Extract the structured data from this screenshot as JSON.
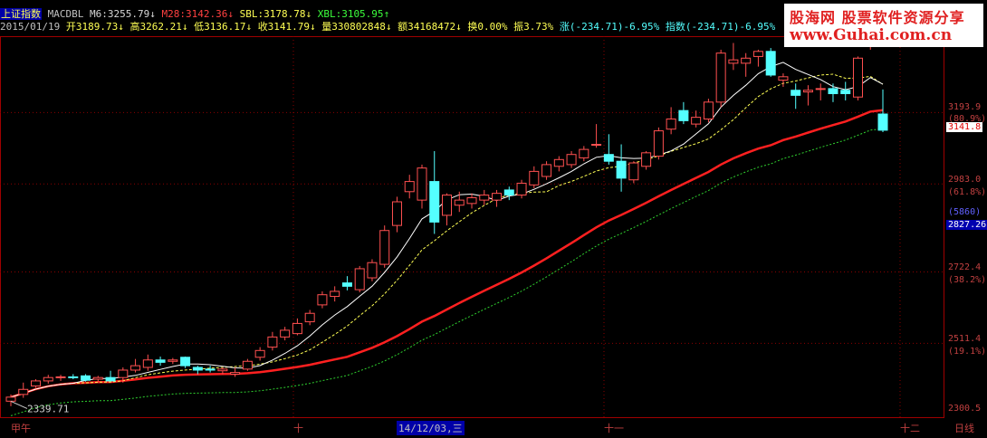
{
  "header": {
    "title": "上证指数",
    "ma_name": "MACDBL",
    "m6": "M6:3255.79",
    "m6_arrow": "↓",
    "m28": "M28:3142.36",
    "m28_arrow": "↓",
    "sbl": "SBL:3178.78",
    "sbl_arrow": "↓",
    "xbl": "XBL:3105.95",
    "xbl_arrow": "↑",
    "date": "2015/01/19",
    "open": "开3189.73",
    "open_arrow": "↓",
    "high": "高3262.21",
    "high_arrow": "↓",
    "low": "低3136.17",
    "low_arrow": "↓",
    "close": "收3141.79",
    "close_arrow": "↓",
    "volume": "量330802848",
    "volume_arrow": "↓",
    "amount": "额34168472",
    "amount_arrow": "↓",
    "turnover": "换0.00%",
    "amplitude": "振3.73%",
    "change": "涨(-234.71)-6.95%",
    "index_change": "指数(-234.71)-6.95%"
  },
  "y_axis": {
    "labels": [
      "3193.9",
      "(80.9%)",
      "2983.0",
      "(61.8%)",
      "(5860)",
      "2827.26",
      "2722.4",
      "(38.2%)",
      "2511.4",
      "(19.1%)",
      "2300.5"
    ],
    "current_price": "3141.8",
    "low_marker": "2339.71"
  },
  "bottom_bar": {
    "labels": [
      "甲午",
      "十",
      "14/12/03,三",
      "十一",
      "十二",
      "日线"
    ]
  },
  "logo": {
    "line1": "股海网 股票软件资源分享",
    "line2": "www.Guhai.com.cn"
  },
  "colors": {
    "up": "#ff5050",
    "down": "#54ffff",
    "ma_short": "#ffffff",
    "ma_mid": "#ffff54",
    "ma_long": "#ff2020",
    "ma_xbl": "#2fcf2f"
  },
  "chart_data": {
    "type": "candlestick",
    "ylim": [
      2290,
      3420
    ],
    "candles": [
      {
        "o": 2340,
        "h": 2360,
        "l": 2325,
        "c": 2352
      },
      {
        "o": 2360,
        "h": 2395,
        "l": 2350,
        "c": 2375
      },
      {
        "o": 2385,
        "h": 2405,
        "l": 2380,
        "c": 2400
      },
      {
        "o": 2400,
        "h": 2418,
        "l": 2392,
        "c": 2410
      },
      {
        "o": 2410,
        "h": 2418,
        "l": 2400,
        "c": 2412
      },
      {
        "o": 2412,
        "h": 2420,
        "l": 2405,
        "c": 2410
      },
      {
        "o": 2415,
        "h": 2420,
        "l": 2398,
        "c": 2402
      },
      {
        "o": 2405,
        "h": 2415,
        "l": 2395,
        "c": 2410
      },
      {
        "o": 2410,
        "h": 2430,
        "l": 2400,
        "c": 2400
      },
      {
        "o": 2410,
        "h": 2440,
        "l": 2395,
        "c": 2432
      },
      {
        "o": 2432,
        "h": 2465,
        "l": 2425,
        "c": 2445
      },
      {
        "o": 2440,
        "h": 2478,
        "l": 2430,
        "c": 2462
      },
      {
        "o": 2462,
        "h": 2472,
        "l": 2445,
        "c": 2455
      },
      {
        "o": 2458,
        "h": 2468,
        "l": 2450,
        "c": 2462
      },
      {
        "o": 2470,
        "h": 2472,
        "l": 2438,
        "c": 2445
      },
      {
        "o": 2440,
        "h": 2445,
        "l": 2420,
        "c": 2432
      },
      {
        "o": 2435,
        "h": 2445,
        "l": 2425,
        "c": 2432
      },
      {
        "o": 2430,
        "h": 2440,
        "l": 2420,
        "c": 2435
      },
      {
        "o": 2420,
        "h": 2440,
        "l": 2412,
        "c": 2425
      },
      {
        "o": 2435,
        "h": 2465,
        "l": 2430,
        "c": 2458
      },
      {
        "o": 2470,
        "h": 2500,
        "l": 2460,
        "c": 2490
      },
      {
        "o": 2500,
        "h": 2545,
        "l": 2490,
        "c": 2530
      },
      {
        "o": 2530,
        "h": 2560,
        "l": 2520,
        "c": 2550
      },
      {
        "o": 2540,
        "h": 2585,
        "l": 2535,
        "c": 2570
      },
      {
        "o": 2575,
        "h": 2610,
        "l": 2565,
        "c": 2600
      },
      {
        "o": 2625,
        "h": 2665,
        "l": 2615,
        "c": 2655
      },
      {
        "o": 2650,
        "h": 2680,
        "l": 2635,
        "c": 2665
      },
      {
        "o": 2690,
        "h": 2710,
        "l": 2668,
        "c": 2680
      },
      {
        "o": 2670,
        "h": 2740,
        "l": 2662,
        "c": 2732
      },
      {
        "o": 2705,
        "h": 2760,
        "l": 2695,
        "c": 2750
      },
      {
        "o": 2745,
        "h": 2860,
        "l": 2735,
        "c": 2845
      },
      {
        "o": 2860,
        "h": 2945,
        "l": 2840,
        "c": 2930
      },
      {
        "o": 2960,
        "h": 3010,
        "l": 2940,
        "c": 2990
      },
      {
        "o": 2935,
        "h": 3040,
        "l": 2910,
        "c": 3030
      },
      {
        "o": 2990,
        "h": 3080,
        "l": 2835,
        "c": 2870
      },
      {
        "o": 2890,
        "h": 2955,
        "l": 2860,
        "c": 2950
      },
      {
        "o": 2920,
        "h": 2960,
        "l": 2900,
        "c": 2935
      },
      {
        "o": 2925,
        "h": 2955,
        "l": 2910,
        "c": 2942
      },
      {
        "o": 2935,
        "h": 2965,
        "l": 2920,
        "c": 2950
      },
      {
        "o": 2935,
        "h": 2965,
        "l": 2915,
        "c": 2955
      },
      {
        "o": 2965,
        "h": 2975,
        "l": 2935,
        "c": 2950
      },
      {
        "o": 2950,
        "h": 2995,
        "l": 2940,
        "c": 2985
      },
      {
        "o": 2980,
        "h": 3035,
        "l": 2970,
        "c": 3020
      },
      {
        "o": 3005,
        "h": 3050,
        "l": 2995,
        "c": 3040
      },
      {
        "o": 3035,
        "h": 3065,
        "l": 3020,
        "c": 3055
      },
      {
        "o": 3040,
        "h": 3080,
        "l": 3030,
        "c": 3070
      },
      {
        "o": 3060,
        "h": 3095,
        "l": 3050,
        "c": 3085
      },
      {
        "o": 3100,
        "h": 3160,
        "l": 3090,
        "c": 3100
      },
      {
        "o": 3070,
        "h": 3130,
        "l": 3040,
        "c": 3050
      },
      {
        "o": 3050,
        "h": 3100,
        "l": 2960,
        "c": 3000
      },
      {
        "o": 2995,
        "h": 3050,
        "l": 2985,
        "c": 3045
      },
      {
        "o": 3035,
        "h": 3080,
        "l": 3025,
        "c": 3075
      },
      {
        "o": 3065,
        "h": 3150,
        "l": 3055,
        "c": 3140
      },
      {
        "o": 3145,
        "h": 3210,
        "l": 3130,
        "c": 3175
      },
      {
        "o": 3200,
        "h": 3225,
        "l": 3160,
        "c": 3170
      },
      {
        "o": 3160,
        "h": 3200,
        "l": 3150,
        "c": 3180
      },
      {
        "o": 3175,
        "h": 3235,
        "l": 3165,
        "c": 3225
      },
      {
        "o": 3225,
        "h": 3380,
        "l": 3210,
        "c": 3370
      },
      {
        "o": 3340,
        "h": 3400,
        "l": 3320,
        "c": 3350
      },
      {
        "o": 3340,
        "h": 3370,
        "l": 3300,
        "c": 3355
      },
      {
        "o": 3360,
        "h": 3380,
        "l": 3330,
        "c": 3375
      },
      {
        "o": 3375,
        "h": 3385,
        "l": 3300,
        "c": 3305
      },
      {
        "o": 3290,
        "h": 3310,
        "l": 3270,
        "c": 3300
      },
      {
        "o": 3260,
        "h": 3280,
        "l": 3205,
        "c": 3245
      },
      {
        "o": 3255,
        "h": 3275,
        "l": 3215,
        "c": 3260
      },
      {
        "o": 3265,
        "h": 3280,
        "l": 3230,
        "c": 3265
      },
      {
        "o": 3265,
        "h": 3280,
        "l": 3225,
        "c": 3250
      },
      {
        "o": 3260,
        "h": 3285,
        "l": 3230,
        "c": 3250
      },
      {
        "o": 3240,
        "h": 3360,
        "l": 3230,
        "c": 3355
      },
      {
        "o": 3400,
        "h": 3420,
        "l": 3380,
        "c": 3405
      },
      {
        "o": 3189.73,
        "h": 3262.21,
        "l": 3136.17,
        "c": 3141.79
      }
    ]
  }
}
